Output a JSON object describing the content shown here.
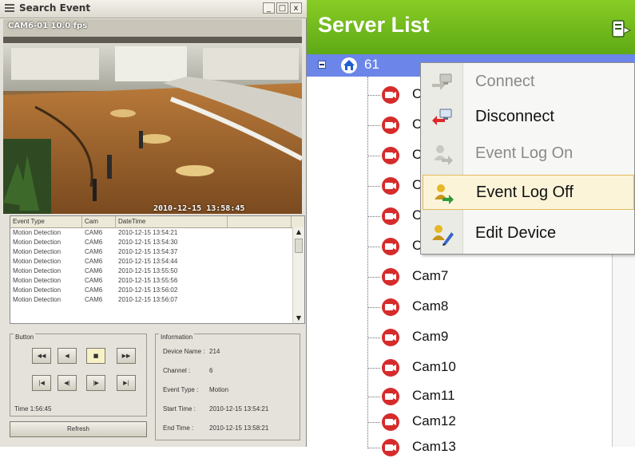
{
  "search_window": {
    "title": "Search Event",
    "controls": [
      "_",
      "□",
      "x"
    ],
    "video": {
      "overlay": "CAM6-01 10.0 fps",
      "timestamp": "2010-12-15 13:58:45"
    },
    "event_list": {
      "columns": [
        "Event Type",
        "Cam",
        "DateTime",
        ""
      ],
      "rows": [
        [
          "Motion Detection",
          "CAM6",
          "2010-12-15 13:54:21"
        ],
        [
          "Motion Detection",
          "CAM6",
          "2010-12-15 13:54:30"
        ],
        [
          "Motion Detection",
          "CAM6",
          "2010-12-15 13:54:37"
        ],
        [
          "Motion Detection",
          "CAM6",
          "2010-12-15 13:54:44"
        ],
        [
          "Motion Detection",
          "CAM6",
          "2010-12-15 13:55:50"
        ],
        [
          "Motion Detection",
          "CAM6",
          "2010-12-15 13:55:56"
        ],
        [
          "Motion Detection",
          "CAM6",
          "2010-12-15 13:56:02"
        ],
        [
          "Motion Detection",
          "CAM6",
          "2010-12-15 13:56:07"
        ]
      ]
    },
    "button_group": {
      "label": "Button",
      "row1": [
        "◀◀",
        "◀",
        "■",
        "▶▶"
      ],
      "row2": [
        "|◀",
        "◀|",
        "|▶",
        "▶|"
      ],
      "active": "■"
    },
    "playback_time": "Time 1:56:45",
    "refresh_label": "Refresh",
    "information": {
      "label": "Information",
      "device_name_key": "Device Name :",
      "device_name_val": "214",
      "channel_key": "Channel :",
      "channel_val": "6",
      "event_type_key": "Event Type :",
      "event_type_val": "Motion",
      "start_time_key": "Start Time :",
      "start_time_val": "2010-12-15 13:54:21",
      "end_time_key": "End Time :",
      "end_time_val": "2010-12-15 13:58:21"
    }
  },
  "server_list": {
    "title": "Server List",
    "header_icon": "server-settings-icon",
    "root": {
      "label": "61",
      "icon": "home-icon"
    },
    "cameras": [
      "Cam1",
      "Cam2",
      "Cam3",
      "Cam4",
      "Cam5",
      "Cam6",
      "Cam7",
      "Cam8",
      "Cam9",
      "Cam10",
      "Cam11",
      "Cam12",
      "Cam13"
    ]
  },
  "context_menu": {
    "items": [
      {
        "label": "Connect",
        "icon": "connect-icon",
        "enabled": false
      },
      {
        "label": "Disconnect",
        "icon": "disconnect-icon",
        "enabled": true
      },
      {
        "label": "Event Log On",
        "icon": "event-log-on-icon",
        "enabled": false
      },
      {
        "label": "Event Log Off",
        "icon": "event-log-off-icon",
        "enabled": true,
        "hover": true
      },
      {
        "label": "Edit Device",
        "icon": "edit-device-icon",
        "enabled": true
      }
    ]
  },
  "colors": {
    "header_green": "#5ea915",
    "selection_blue": "#6b86e8",
    "camera_red": "#d62b2b",
    "menu_hover": "#fbf4d9"
  }
}
